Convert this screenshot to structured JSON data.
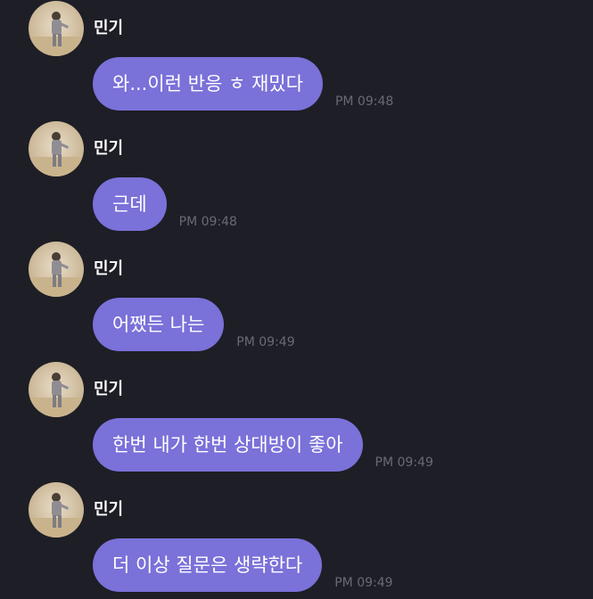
{
  "messages": [
    {
      "sender": "민기",
      "text": "와...이런 반응 ㅎ 재밌다",
      "time": "PM 09:48",
      "avatar": "avatar-photo"
    },
    {
      "sender": "민기",
      "text": "근데",
      "time": "PM 09:48",
      "avatar": "avatar-photo"
    },
    {
      "sender": "민기",
      "text": "어쨌든 나는",
      "time": "PM 09:49",
      "avatar": "avatar-photo"
    },
    {
      "sender": "민기",
      "text": "한번 내가 한번 상대방이 좋아",
      "time": "PM 09:49",
      "avatar": "avatar-photo"
    },
    {
      "sender": "민기",
      "text": "더 이상 질문은 생략한다",
      "time": "PM 09:49",
      "avatar": "avatar-photo"
    }
  ],
  "colors": {
    "background": "#1e1e26",
    "bubble": "#7a71d9",
    "sender_text": "#ffffff",
    "time_text": "#6a6a74"
  }
}
